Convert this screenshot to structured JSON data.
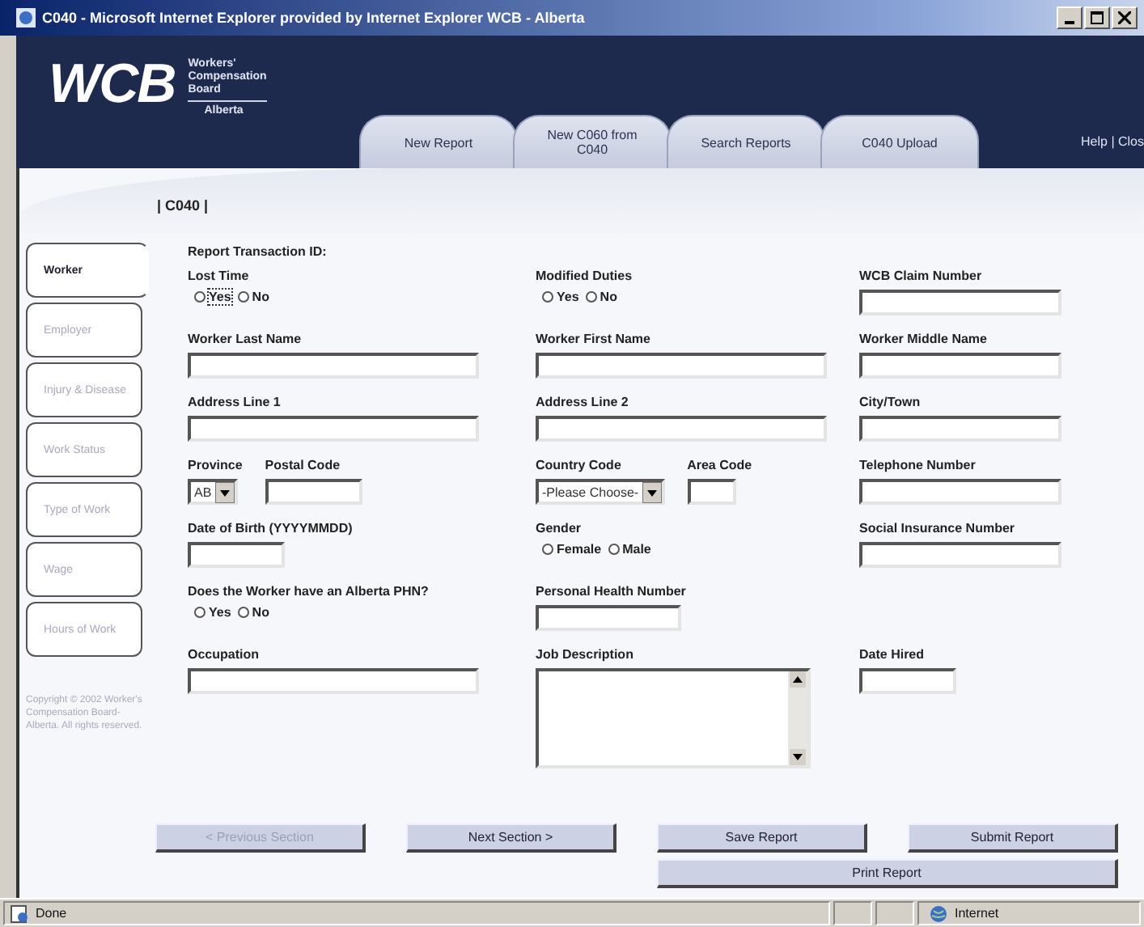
{
  "window": {
    "title": "C040 - Microsoft Internet Explorer provided by Internet Explorer WCB - Alberta"
  },
  "logo": {
    "mark": "WCB",
    "lines": [
      "Workers'",
      "Compensation",
      "Board"
    ],
    "region": "Alberta"
  },
  "tabs": [
    {
      "label": "New Report",
      "selected": false
    },
    {
      "label": "New C060 from C040",
      "selected": false
    },
    {
      "label": "Search Reports",
      "selected": false
    },
    {
      "label": "C040 Upload",
      "selected": false
    }
  ],
  "help_links": "Help | Clos",
  "form_code": "| C040 |",
  "side_tabs": [
    {
      "label": "Worker",
      "selected": true
    },
    {
      "label": "Employer",
      "selected": false
    },
    {
      "label": "Injury & Disease",
      "selected": false
    },
    {
      "label": "Work Status",
      "selected": false
    },
    {
      "label": "Type of Work",
      "selected": false
    },
    {
      "label": "Wage",
      "selected": false
    },
    {
      "label": "Hours of Work",
      "selected": false
    }
  ],
  "copyright": "Copyright © 2002 Worker's Compensation Board-Alberta. All rights reserved.",
  "rows": [
    {
      "left": [
        {
          "kind": "label",
          "label": "Report Transaction ID:"
        }
      ]
    },
    {
      "left": [
        {
          "kind": "radio",
          "label": "Lost Time",
          "options": [
            {
              "label": "Yes",
              "selected": false,
              "focused": true
            },
            {
              "label": "No",
              "selected": false,
              "focused": false
            }
          ]
        }
      ],
      "middle": [
        {
          "kind": "radio",
          "label": "Modified Duties",
          "options": [
            {
              "label": "Yes",
              "selected": false
            },
            {
              "label": "No",
              "selected": false
            }
          ]
        }
      ],
      "right": [
        {
          "kind": "mediumtext",
          "label": "WCB Claim Number"
        }
      ]
    },
    {
      "left": [
        {
          "kind": "longtext",
          "label": "Worker Last Name"
        }
      ],
      "middle": [
        {
          "kind": "longtext",
          "label": "Worker First Name"
        }
      ],
      "right": [
        {
          "kind": "mediumtext",
          "label": "Worker Middle Name"
        }
      ]
    },
    {
      "left": [
        {
          "kind": "longtext",
          "label": "Address Line 1"
        }
      ],
      "middle": [
        {
          "kind": "longtext",
          "label": "Address Line 2"
        }
      ],
      "right": [
        {
          "kind": "mediumtext",
          "label": "City/Town"
        }
      ]
    },
    {
      "left": [
        {
          "kind": "select",
          "label": "Province",
          "value": "AB"
        },
        {
          "kind": "shorttext",
          "label": "Postal Code"
        }
      ],
      "middle": [
        {
          "kind": "select",
          "label": "Country Code",
          "value": "-Please Choose-"
        },
        {
          "kind": "tinytext",
          "label": "Area Code"
        }
      ],
      "right": [
        {
          "kind": "mediumtext",
          "label": "Telephone Number"
        }
      ]
    },
    {
      "left": [
        {
          "kind": "shorttext",
          "label": "Date of Birth (YYYYMMDD)"
        }
      ],
      "middle": [
        {
          "kind": "radio",
          "label": "Gender",
          "options": [
            {
              "label": "Female",
              "selected": false
            },
            {
              "label": "Male",
              "selected": false
            }
          ]
        }
      ],
      "right": [
        {
          "kind": "mediumtext",
          "label": "Social Insurance Number"
        }
      ]
    },
    {
      "left": [
        {
          "kind": "radio",
          "label": "Does the Worker have an Alberta PHN?",
          "options": [
            {
              "label": "Yes",
              "selected": false
            },
            {
              "label": "No",
              "selected": false
            }
          ]
        }
      ],
      "middle": [
        {
          "kind": "smalltext",
          "label": "Personal Health Number"
        }
      ]
    },
    {
      "left": [
        {
          "kind": "longtext",
          "label": "Occupation"
        }
      ],
      "middle": [
        {
          "kind": "textarea",
          "label": "Job Description"
        }
      ],
      "right": [
        {
          "kind": "shorttext",
          "label": "Date Hired"
        }
      ]
    }
  ],
  "buttons": [
    {
      "label": "< Previous Section",
      "disabled": true,
      "kind": "normal"
    },
    {
      "label": "Next Section >",
      "disabled": false,
      "kind": "normal"
    },
    {
      "label": "Save Report",
      "disabled": false,
      "kind": "normal"
    },
    {
      "label": "Submit Report",
      "disabled": false,
      "kind": "normal"
    },
    {
      "label": "Print Report",
      "disabled": false,
      "kind": "wide"
    }
  ],
  "status_bar": {
    "text": "Done",
    "zone": "Internet"
  }
}
